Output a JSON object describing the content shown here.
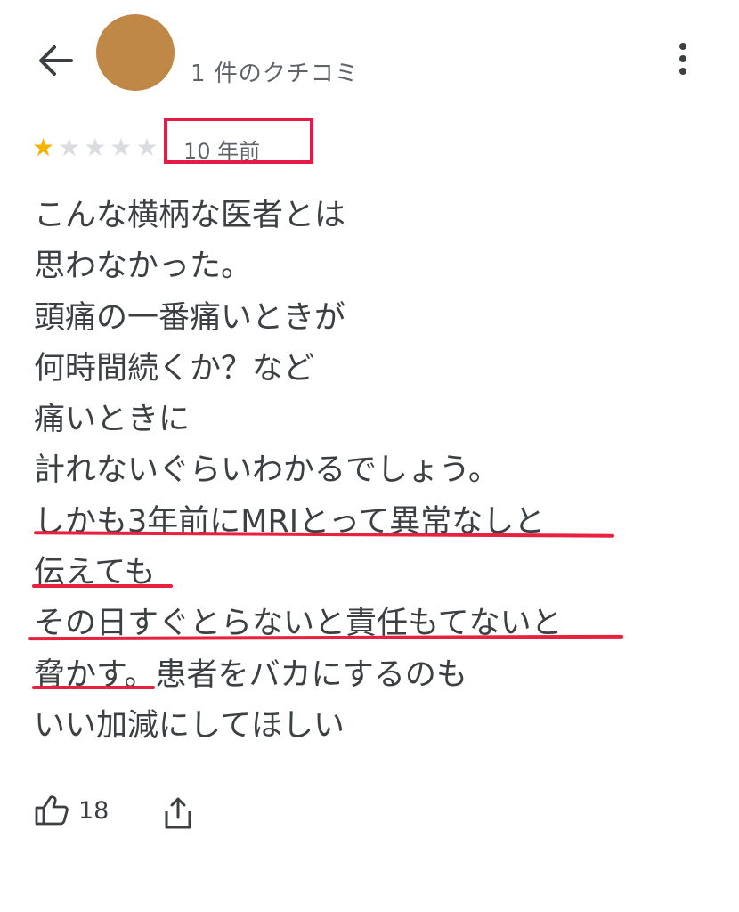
{
  "header": {
    "back_icon": "arrow-left-icon",
    "avatar_color": "#bf8847",
    "review_count": "1 件のクチコミ",
    "more_icon": "more-vert-icon"
  },
  "review": {
    "rating": 1,
    "max_rating": 5,
    "star_color": "#f4b400",
    "date": "10 年前",
    "highlight_color": "#e51a46",
    "lines": [
      "こんな横柄な医者とは",
      "思わなかった。",
      "頭痛の一番痛いときが",
      "何時間続くか？など",
      "痛いときに",
      "計れないぐらいわかるでしょう。",
      "しかも3年前にMRIとって異常なしと",
      "伝えても",
      "その日すぐとらないと責任もてないと",
      "脅かす。患者をバカにするのも",
      "いい加減にしてほしい"
    ],
    "underlined_lines": [
      6,
      7,
      8,
      9
    ]
  },
  "actions": {
    "like_icon": "thumbs-up-icon",
    "like_count": "18",
    "share_icon": "share-icon"
  }
}
